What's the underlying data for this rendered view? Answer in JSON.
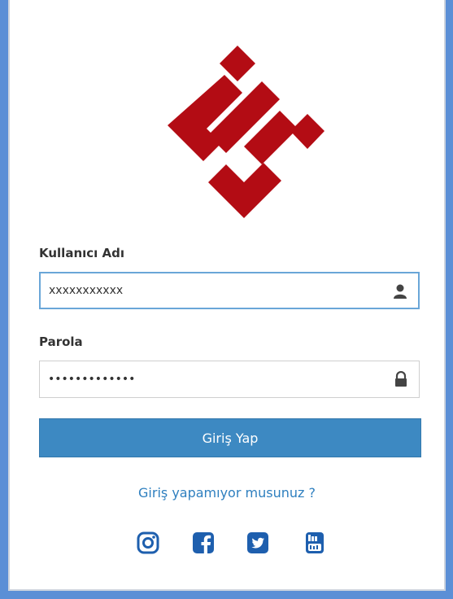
{
  "brand": {
    "logo_color": "#b30c14",
    "logo_icon": "brand-logo"
  },
  "login_form": {
    "username_label": "Kullanıcı Adı",
    "username_value": "xxxxxxxxxxx",
    "username_icon": "user-icon",
    "password_label": "Parola",
    "password_value": "•••••••••••••",
    "password_icon": "lock-icon",
    "submit_label": "Giriş Yap",
    "help_link": "Giriş yapamıyor musunuz ?"
  },
  "social_links": [
    {
      "name": "instagram-icon"
    },
    {
      "name": "facebook-icon"
    },
    {
      "name": "twitter-icon"
    },
    {
      "name": "youtube-icon"
    }
  ],
  "colors": {
    "accent": "#3d89c2",
    "link": "#2e7fbf",
    "social": "#1e5fae",
    "background": "#5b8fd6"
  }
}
